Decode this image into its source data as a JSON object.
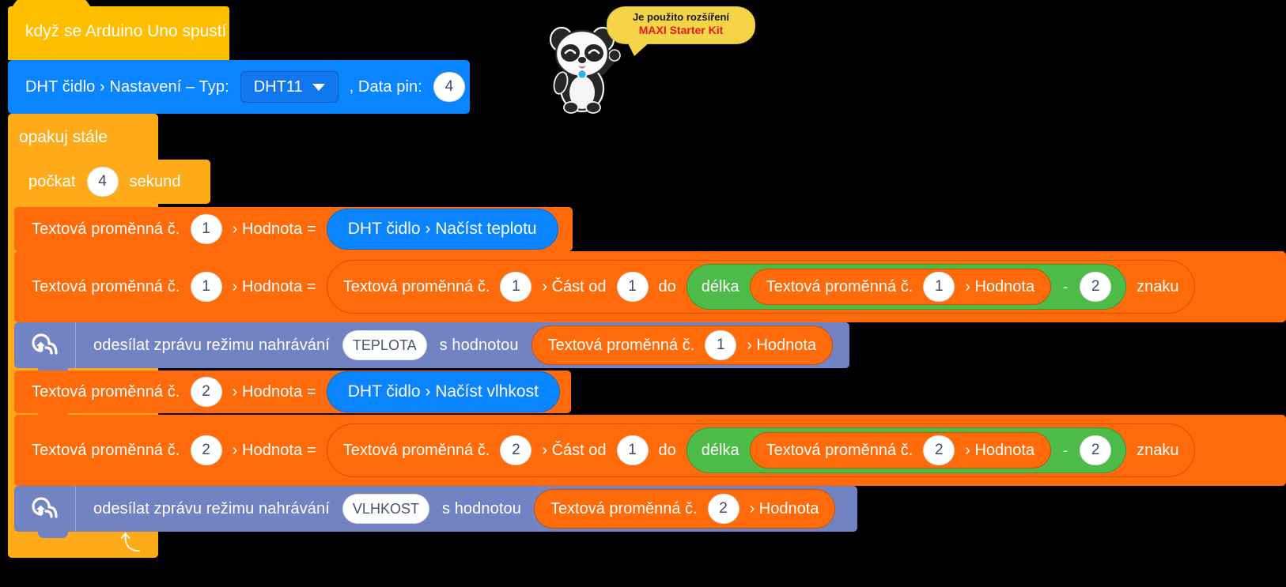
{
  "program": {
    "hat": {
      "label": "když se Arduino Uno spustí"
    },
    "dht_setup": {
      "prefix": "DHT čidlo › Nastavení – Typ:",
      "type_value": "DHT11",
      "pin_label": ", Data pin:",
      "pin_value": "4"
    },
    "forever": {
      "label": "opakuj stále"
    },
    "wait": {
      "prefix": "počkat",
      "value": "4",
      "suffix": "sekund"
    },
    "rows": [
      {
        "id": "set-temp",
        "var_prefix": "Textová proměnná č.",
        "var_index": "1",
        "value_label": "› Hodnota =",
        "reporter": "DHT čidlo › Načíst teplotu"
      },
      {
        "id": "trim-temp",
        "var_prefix": "Textová proměnná č.",
        "var_index": "1",
        "value_label": "› Hodnota =",
        "inner_var_prefix": "Textová proměnná č.",
        "inner_var_index": "1",
        "part_from_label": "› Část od",
        "from_value": "1",
        "to_label": "do",
        "length_label": "délka",
        "len_var_prefix": "Textová proměnná č.",
        "len_var_index": "1",
        "len_value_label": "› Hodnota",
        "minus": "-",
        "minus_value": "2",
        "chars_label": "znaku"
      },
      {
        "id": "upload-temp",
        "icon": "cloud-upload-icon",
        "label": "odesílat zprávu režimu nahrávání",
        "topic": "TEPLOTA",
        "with_value_label": "s hodnotou",
        "var_prefix": "Textová proměnná č.",
        "var_index": "1",
        "value_label": "› Hodnota"
      },
      {
        "id": "set-hum",
        "var_prefix": "Textová proměnná č.",
        "var_index": "2",
        "value_label": "› Hodnota =",
        "reporter": "DHT čidlo › Načíst vlhkost"
      },
      {
        "id": "trim-hum",
        "var_prefix": "Textová proměnná č.",
        "var_index": "2",
        "value_label": "› Hodnota =",
        "inner_var_prefix": "Textová proměnná č.",
        "inner_var_index": "2",
        "part_from_label": "› Část od",
        "from_value": "1",
        "to_label": "do",
        "length_label": "délka",
        "len_var_prefix": "Textová proměnná č.",
        "len_var_index": "2",
        "len_value_label": "› Hodnota",
        "minus": "-",
        "minus_value": "2",
        "chars_label": "znaku"
      },
      {
        "id": "upload-hum",
        "icon": "cloud-upload-icon",
        "label": "odesílat zprávu režimu nahrávání",
        "topic": "VLHKOST",
        "with_value_label": "s hodnotou",
        "var_prefix": "Textová proměnná č.",
        "var_index": "2",
        "value_label": "› Hodnota"
      }
    ]
  },
  "mascot": {
    "bubble_line1": "Je použito rozšíření",
    "bubble_line2": "MAXI Starter Kit"
  },
  "colors": {
    "hat": "#FFBF00",
    "control": "#FFAB19",
    "sensor_blue": "#0A84FF",
    "data_orange": "#FF6B0A",
    "operator_green": "#4CBB47",
    "iot_slate": "#7183C2",
    "bubble_yellow": "#F5D547",
    "bubble_accent": "#E01B1B",
    "background": "#000000"
  }
}
